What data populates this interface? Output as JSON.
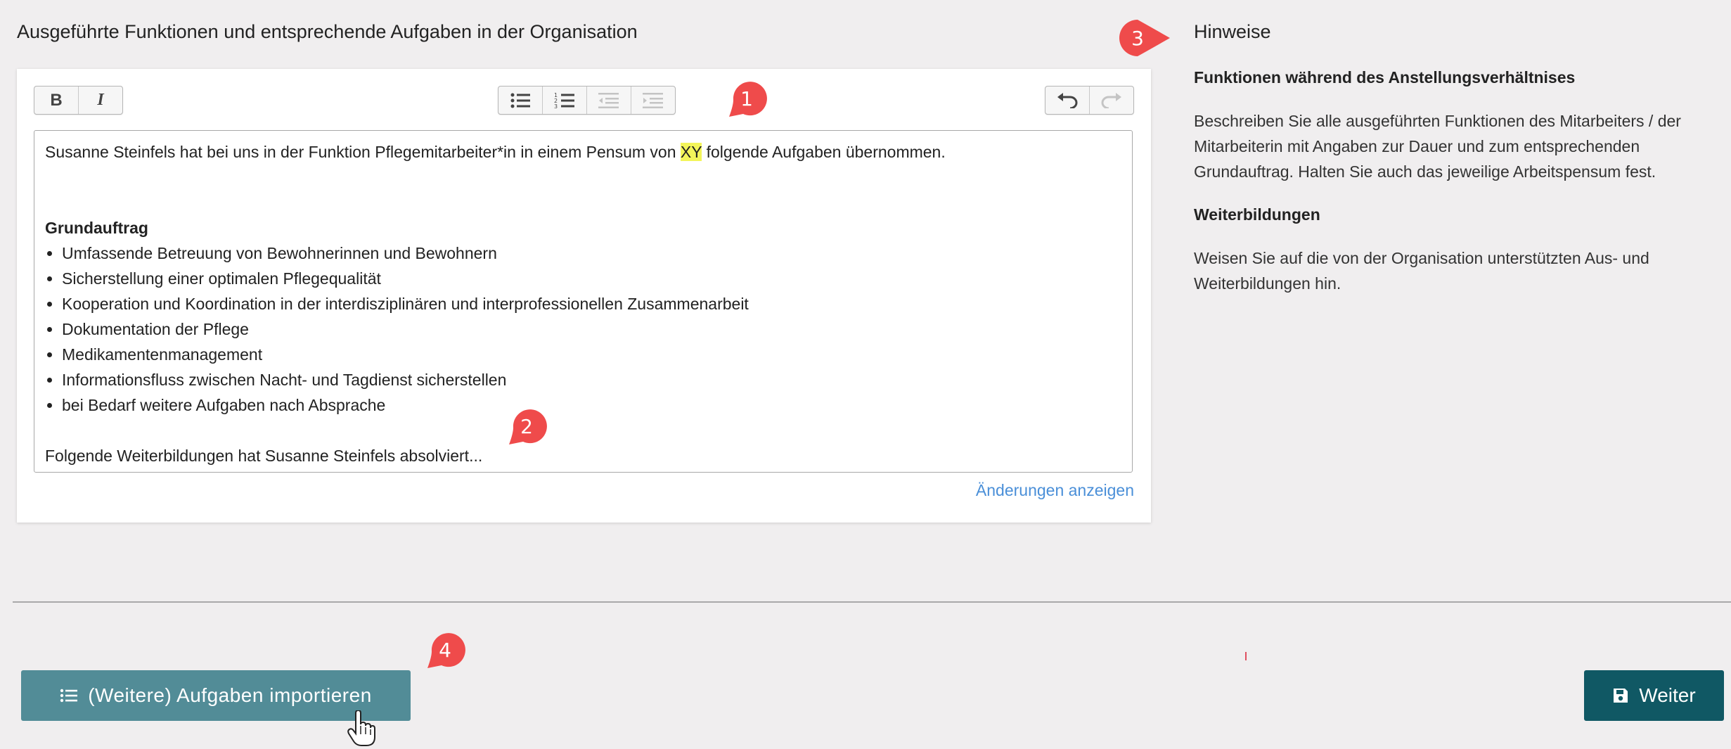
{
  "section_title": "Ausgeführte Funktionen und entsprechende Aufgaben in der Organisation",
  "toolbar": {
    "bold": "B",
    "italic": "I",
    "bullet_list_icon": "bullet-list-icon",
    "numbered_list_icon": "numbered-list-icon",
    "outdent_icon": "outdent-icon",
    "indent_icon": "indent-icon",
    "undo_icon": "undo-icon",
    "redo_icon": "redo-icon"
  },
  "editor": {
    "intro_before": "Susanne Steinfels hat bei uns in der Funktion Pflegemitarbeiter*in in einem Pensum von ",
    "intro_highlight": "XY",
    "intro_after": " folgende Aufgaben übernommen.",
    "heading": "Grundauftrag",
    "items": [
      "Umfassende Betreuung von Bewohnerinnen und Bewohnern",
      "Sicherstellung einer optimalen Pflegequalität",
      "Kooperation und Koordination in der interdisziplinären und interprofessionellen Zusammenarbeit",
      "Dokumentation der Pflege",
      "Medikamentenmanagement",
      "Informationsfluss zwischen Nacht- und Tagdienst sicherstellen",
      "bei Bedarf weitere Aufgaben nach Absprache"
    ],
    "closing": "Folgende Weiterbildungen hat Susanne Steinfels absolviert..."
  },
  "changes_link": "Änderungen anzeigen",
  "hints": {
    "title": "Hinweise",
    "sections": [
      {
        "heading": "Funktionen während des Anstellungsverhältnises",
        "text": "Beschreiben Sie alle ausgeführten Funktionen des Mitarbeiters / der Mitarbeiterin mit Angaben zur Dauer und zum entsprechenden Grundauftrag. Halten Sie auch das jeweilige Arbeitspensum fest."
      },
      {
        "heading": "Weiterbildungen",
        "text": "Weisen Sie auf die von der Organisation unterstützten Aus- und Weiterbildungen hin."
      }
    ]
  },
  "buttons": {
    "import_label": "(Weitere) Aufgaben importieren",
    "import_icon": "list-icon",
    "next_label": "Weiter",
    "next_icon": "save-icon"
  },
  "markers": [
    "1",
    "2",
    "3",
    "4"
  ],
  "colors": {
    "marker": "#ef4b4b",
    "highlight": "#f3f55a",
    "link": "#4a8fd8",
    "import_button": "#528c97",
    "next_button": "#105864"
  }
}
